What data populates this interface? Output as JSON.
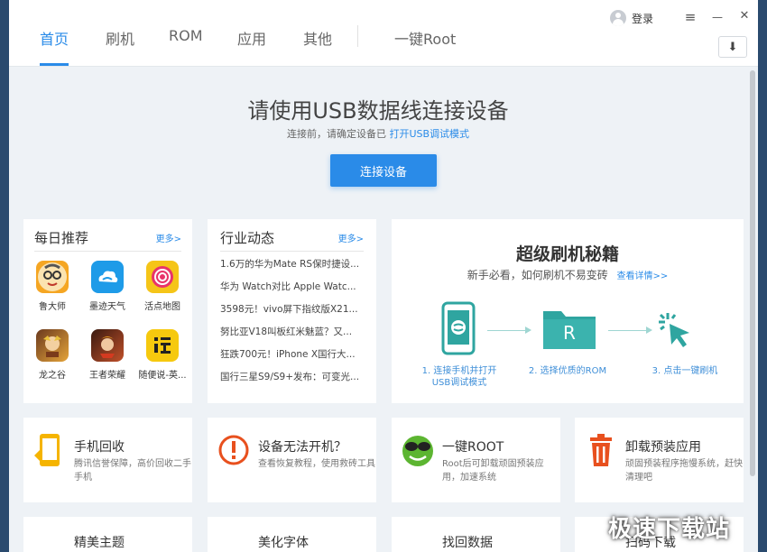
{
  "nav": {
    "tabs": [
      {
        "label": "首页",
        "active": true
      },
      {
        "label": "刷机",
        "active": false
      },
      {
        "label": "ROM",
        "active": false
      },
      {
        "label": "应用",
        "active": false
      },
      {
        "label": "其他",
        "active": false
      },
      {
        "label": "一键Root",
        "active": false
      }
    ],
    "login_label": "登录",
    "menu_glyph": "≡",
    "minimize_glyph": "—",
    "close_glyph": "✕",
    "download_glyph": "⬇"
  },
  "connect": {
    "title": "请使用USB数据线连接设备",
    "sub_prefix": "连接前，请确定设备已",
    "sub_link": "打开USB调试模式",
    "button": "连接设备"
  },
  "daily": {
    "title": "每日推荐",
    "more": "更多>",
    "apps": [
      {
        "name": "鲁大师",
        "icon": "ludashi-icon",
        "color": "#f5a623"
      },
      {
        "name": "墨迹天气",
        "icon": "moji-weather-icon",
        "color": "#1e9be8"
      },
      {
        "name": "活点地图",
        "icon": "huodian-map-icon",
        "color": "#f5c518"
      },
      {
        "name": "龙之谷",
        "icon": "dragon-nest-icon",
        "color": "#c8872a"
      },
      {
        "name": "王者荣耀",
        "icon": "honor-of-kings-icon",
        "color": "#a8342a"
      },
      {
        "name": "随便说-英...",
        "icon": "suibianshuo-icon",
        "color": "#f6c90e"
      }
    ]
  },
  "news": {
    "title": "行业动态",
    "more": "更多>",
    "items": [
      "1.6万的华为Mate RS保时捷设...",
      "华为 Watch对比 Apple Watc...",
      "3598元！vivo屏下指纹版X21...",
      "努比亚V18叫板红米魅蓝？又...",
      "狂跌700元！iPhone X国行大...",
      "国行三星S9/S9+发布：可变光..."
    ]
  },
  "secrets": {
    "title": "超级刷机秘籍",
    "sub": "新手必看，如何刷机不易变砖",
    "link": "查看详情>>",
    "steps": [
      {
        "label": "1. 连接手机并打开",
        "label2": "USB调试模式"
      },
      {
        "label": "2. 选择优质的ROM",
        "label2": ""
      },
      {
        "label": "3. 点击一键刷机",
        "label2": ""
      }
    ],
    "folder_letter": "R"
  },
  "features": [
    {
      "title": "手机回收",
      "desc": "腾讯信誉保障，高价回收二手手机",
      "icon": "phone-recycle-icon"
    },
    {
      "title": "设备无法开机？",
      "desc": "查看恢复教程，使用救砖工具",
      "icon": "warning-icon"
    },
    {
      "title": "一键ROOT",
      "desc": "Root后可卸载顽固预装应用，加速系统",
      "icon": "root-frog-icon"
    },
    {
      "title": "卸载预装应用",
      "desc": "顽固预装程序拖慢系统，赶快清理吧",
      "icon": "trash-icon"
    }
  ],
  "bottom_row": [
    {
      "title": "精美主题"
    },
    {
      "title": "美化字体"
    },
    {
      "title": "找回数据"
    },
    {
      "title": "扫码下载"
    }
  ],
  "watermark": "极速下载站"
}
